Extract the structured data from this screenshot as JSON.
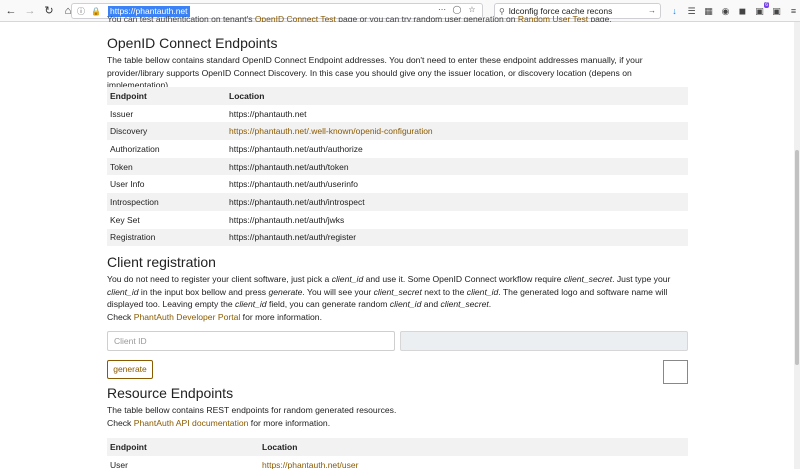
{
  "browser": {
    "url": "https://phantauth.net",
    "search_text": "ldconfig force cache recons",
    "icons": [
      "back-icon",
      "forward-icon",
      "reload-icon",
      "home-icon",
      "info-icon",
      "lock-icon",
      "more-icon",
      "pocket-icon",
      "star-icon",
      "search-icon",
      "go-arrow-icon",
      "download-icon",
      "library-icon",
      "sidebar-icon",
      "reader-icon",
      "container-icon",
      "extension-icon",
      "menu-icon"
    ],
    "badge_count": "6",
    "colors": {
      "accent": "#0a84ff",
      "link": "#8a5a00"
    }
  },
  "top_cut": {
    "pre": "You can test authentication on tenant's ",
    "link1": "OpenID Connect Test",
    "mid": " page or you can try random user generation on ",
    "link2": "Random User Test",
    "post": " page."
  },
  "oidc": {
    "title": "OpenID Connect Endpoints",
    "description": "The table bellow contains standard OpenID Connect Endpoint addresses. You don't need to enter these endpoint addresses manually, if your provider/library supports OpenID Connect Discovery. In this case you should give ony the issuer location, or discovery location (depens on implementation).",
    "headers": [
      "Endpoint",
      "Location"
    ],
    "rows": [
      {
        "name": "Issuer",
        "location": "https://phantauth.net",
        "link": false
      },
      {
        "name": "Discovery",
        "location": "https://phantauth.net/.well-known/openid-configuration",
        "link": true
      },
      {
        "name": "Authorization",
        "location": "https://phantauth.net/auth/authorize",
        "link": false
      },
      {
        "name": "Token",
        "location": "https://phantauth.net/auth/token",
        "link": false
      },
      {
        "name": "User Info",
        "location": "https://phantauth.net/auth/userinfo",
        "link": false
      },
      {
        "name": "Introspection",
        "location": "https://phantauth.net/auth/introspect",
        "link": false
      },
      {
        "name": "Key Set",
        "location": "https://phantauth.net/auth/jwks",
        "link": false
      },
      {
        "name": "Registration",
        "location": "https://phantauth.net/auth/register",
        "link": false
      }
    ]
  },
  "client": {
    "title": "Client registration",
    "p1": "You do not need to register your client software, just pick a ",
    "p1_em1": "client_id",
    "p1_b": " and use it. Some OpenID Connect workflow require ",
    "p1_em2": "client_secret",
    "p1_c": ". Just type your ",
    "p1_em3": "client_id",
    "p1_d": " in the input box bellow and press ",
    "p1_em4": "generate",
    "p1_e": ". You will see your ",
    "p1_em5": "client_secret",
    "p1_f": " next to the ",
    "p1_em6": "client_id",
    "p1_g": ". The generated logo and software name will displayed too. Leaving empty the ",
    "p1_em7": "client_id",
    "p1_h": " field, you can generate random ",
    "p1_em8": "client_id",
    "p1_i": " and ",
    "p1_em9": "client_secret",
    "p1_j": ".",
    "check_pre": "Check ",
    "check_link": "PhantAuth Developer Portal",
    "check_post": " for more information.",
    "input_placeholder": "Client ID",
    "generate_label": "generate"
  },
  "resource": {
    "title": "Resource Endpoints",
    "description": "The table bellow contains REST endpoints for random generated resources.",
    "check_pre": "Check ",
    "check_link": "PhantAuth API documentation",
    "check_post": " for more information.",
    "headers": [
      "Endpoint",
      "Location"
    ],
    "rows": [
      {
        "name": "User",
        "location": "https://phantauth.net/user"
      }
    ]
  }
}
